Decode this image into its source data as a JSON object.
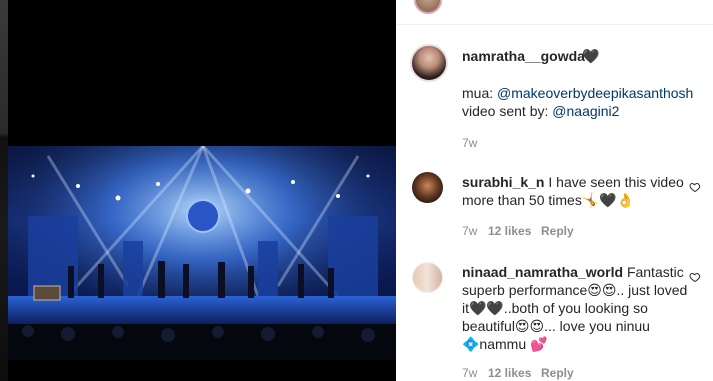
{
  "post": {
    "author": "namratha__gowda",
    "author_heart": "🖤",
    "caption_line1_prefix": "mua: ",
    "caption_line1_mention": "@makeoverbydeepikasanthosh",
    "caption_line2_prefix": "video sent by: ",
    "caption_line2_mention": "@naagini2",
    "time": "7w"
  },
  "comments": [
    {
      "username": "surabhi_k_n",
      "text": "I have seen this video more than 50 times🤸🖤👌",
      "time": "7w",
      "likes": "12 likes",
      "reply_label": "Reply"
    },
    {
      "username": "ninaad_namratha_world",
      "text": "Fantastic superb performance😍😍.. just loved it🖤🖤..both of you looking so beautiful😍😍... love you ninuu 💠nammu 💕",
      "time": "7w",
      "likes": "12 likes",
      "reply_label": "Reply"
    }
  ],
  "icons": {
    "like": "heart-outline-icon"
  },
  "colors": {
    "link": "#00376b",
    "muted": "#8e8e8e",
    "text": "#262626"
  }
}
